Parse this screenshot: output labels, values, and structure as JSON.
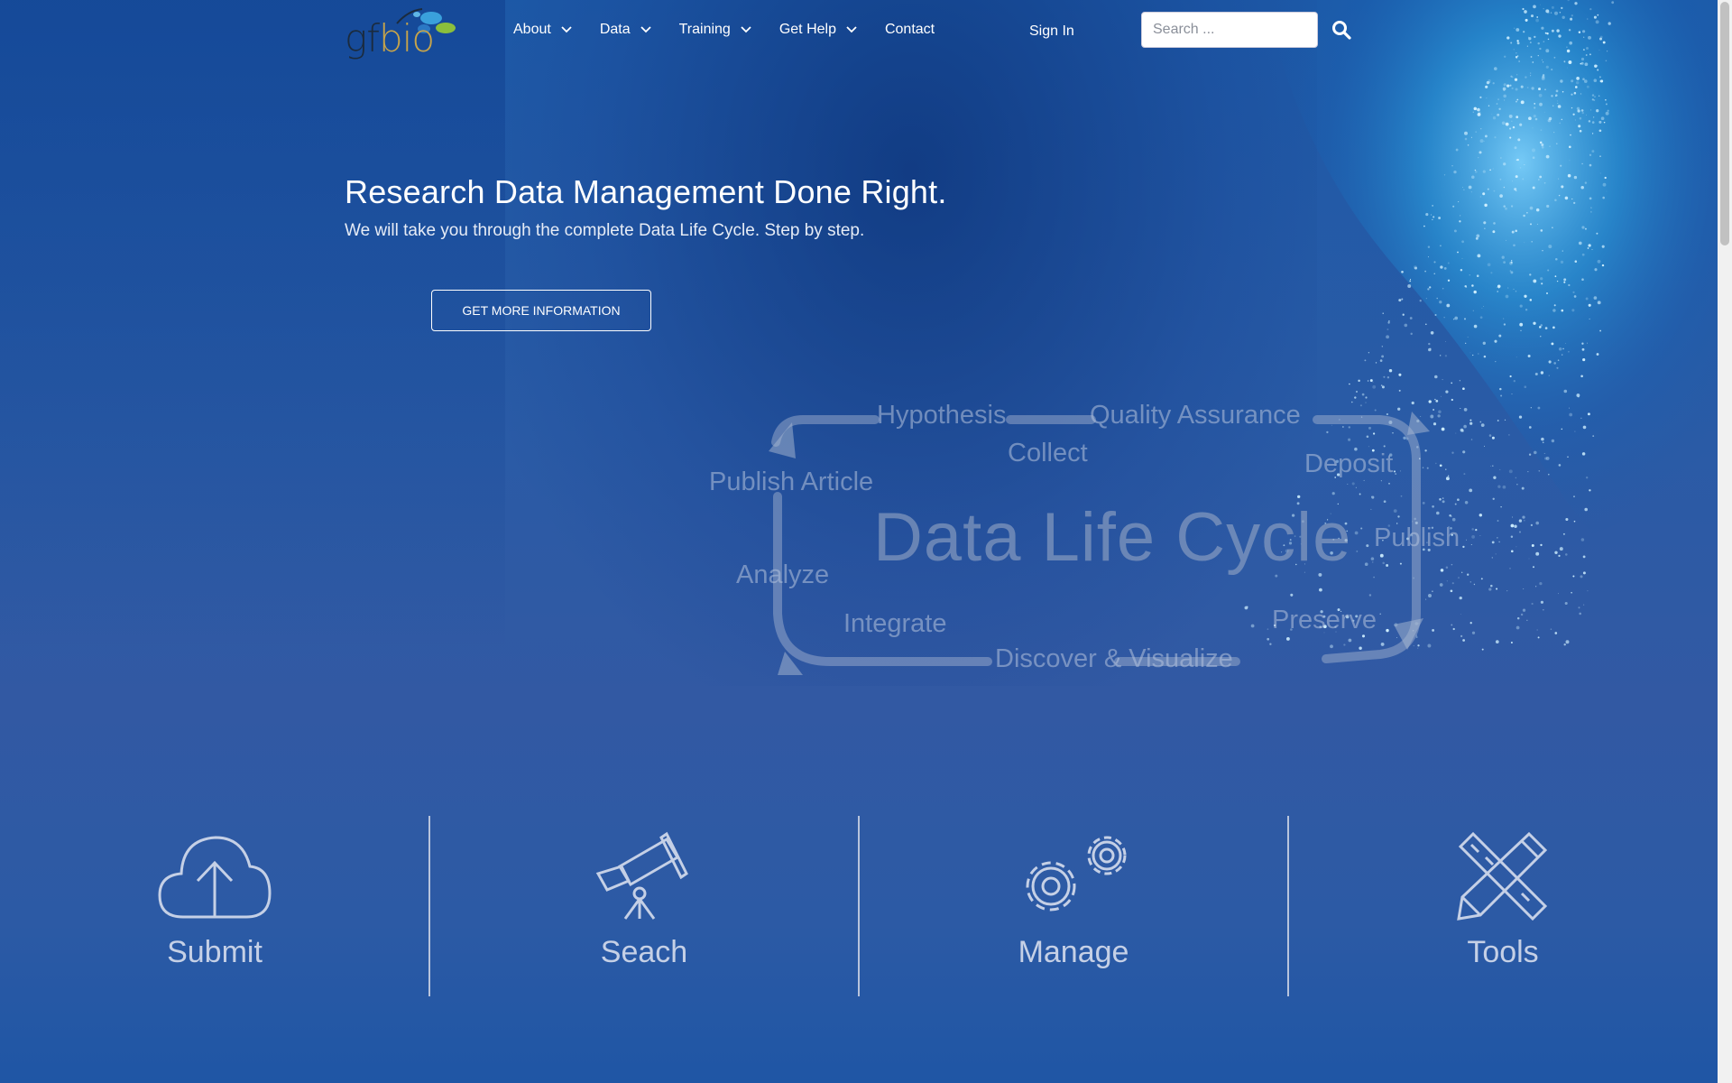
{
  "header": {
    "logo_text_g": "gf",
    "logo_text_b": "bio",
    "nav": [
      {
        "label": "About",
        "has_dropdown": true
      },
      {
        "label": "Data",
        "has_dropdown": true
      },
      {
        "label": "Training",
        "has_dropdown": true
      },
      {
        "label": "Get Help",
        "has_dropdown": true
      },
      {
        "label": "Contact",
        "has_dropdown": false
      }
    ],
    "sign_in": "Sign In",
    "search": {
      "placeholder": "Search ...",
      "value": "",
      "icon": "search-icon"
    }
  },
  "hero": {
    "title": "Research Data Management Done Right.",
    "subtitle": "We will take you through the complete Data Life Cycle. Step by step.",
    "cta": "GET MORE INFORMATION"
  },
  "cycle": {
    "center": "Data Life Cycle",
    "labels": {
      "hypothesis": "Hypothesis",
      "quality": "Quality Assurance",
      "collect": "Collect",
      "deposit": "Deposit",
      "publish_article": "Publish Article",
      "publish": "Publish",
      "analyze": "Analyze",
      "integrate": "Integrate",
      "preserve": "Preserve",
      "discover": "Discover & Visualize"
    }
  },
  "features": [
    {
      "label": "Submit",
      "icon": "cloud-upload-icon"
    },
    {
      "label": "Seach",
      "icon": "telescope-icon"
    },
    {
      "label": "Manage",
      "icon": "gears-icon"
    },
    {
      "label": "Tools",
      "icon": "ruler-pencil-icon"
    }
  ],
  "colors": {
    "background": "#2a5ba6",
    "accent_text": "#c5d0e6",
    "logo_blue": "#3aa0dc",
    "logo_green": "#8bbf3c"
  }
}
